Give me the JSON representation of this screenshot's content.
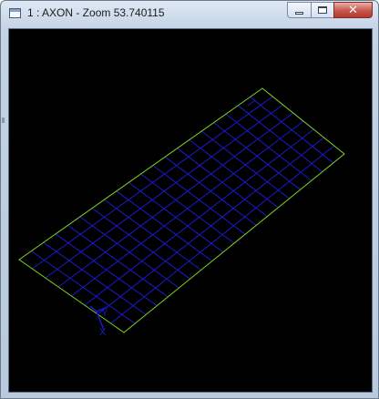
{
  "window": {
    "title": "1 : AXON - Zoom 53.740115",
    "icon": "app-icon",
    "buttons": {
      "minimize": "minimize-icon",
      "maximize": "maximize-icon",
      "close": "close-icon"
    }
  },
  "viewport": {
    "background": "#000000",
    "boundary_color": "#7fd321",
    "mesh_color": "#1a1acc",
    "axis_color": "#1a1acc",
    "axis_labels": {
      "x": "X",
      "y": "Y",
      "z": "Z"
    }
  },
  "colors": {
    "close_button": "#c6554a",
    "titlebar": "#c4d3e6"
  }
}
